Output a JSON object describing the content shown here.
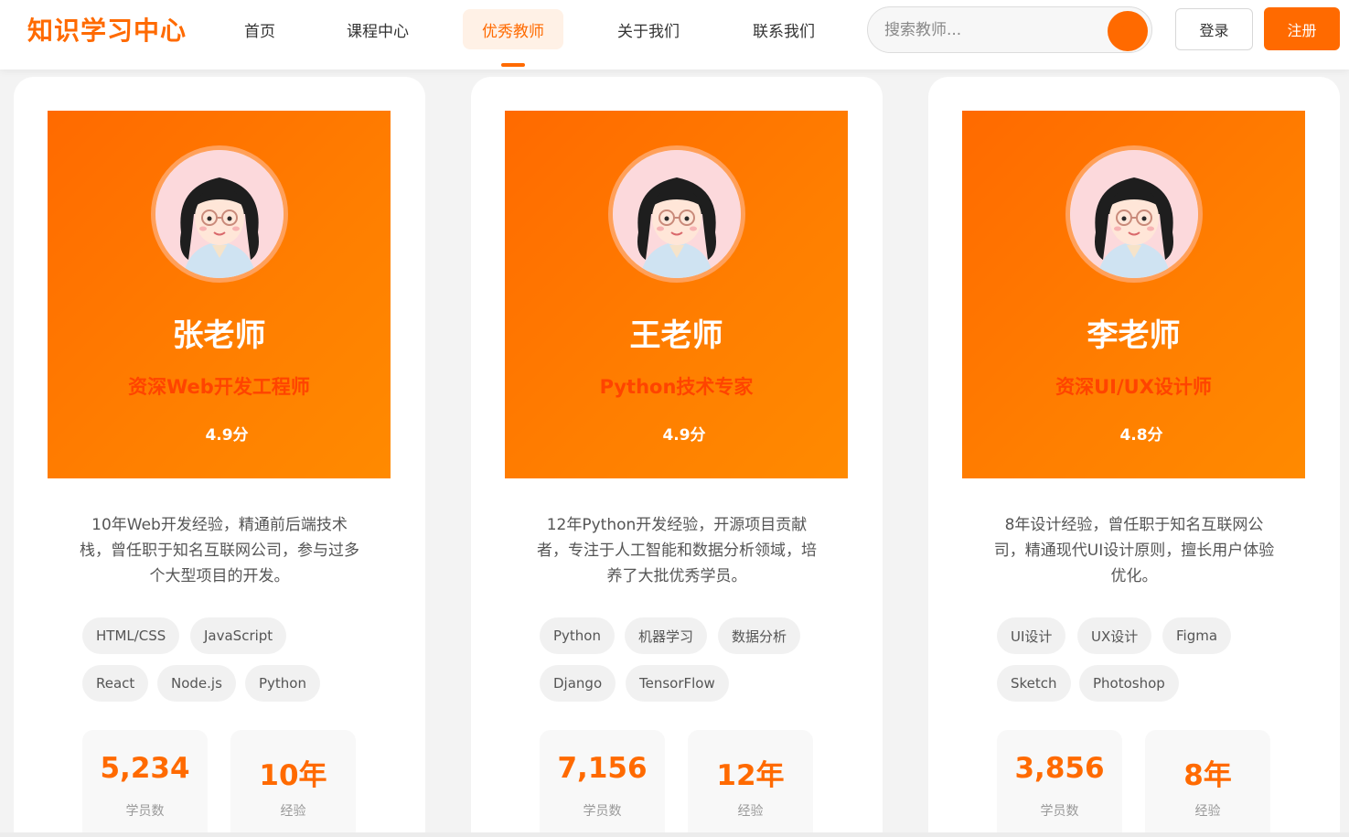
{
  "colors": {
    "accent": "#ff6a00",
    "title_on_hero": "#ff4400"
  },
  "header": {
    "logo": "知识学习中心",
    "nav": [
      "首页",
      "课程中心",
      "优秀教师",
      "关于我们",
      "联系我们"
    ],
    "active_nav": "优秀教师",
    "search": {
      "placeholder": "搜索教师...",
      "icon": "search-icon"
    },
    "login": "登录",
    "register": "注册"
  },
  "teachers": [
    {
      "name": "张老师",
      "title": "资深Web开发工程师",
      "rating": "4.9分",
      "desc": "10年Web开发经验，精通前后端技术栈，曾任职于知名互联网公司，参与过多个大型项目的开发。",
      "tags": [
        "HTML/CSS",
        "JavaScript",
        "React",
        "Node.js",
        "Python"
      ],
      "students": "5,234",
      "students_label": "学员数",
      "experience": "10年",
      "experience_label": "经验"
    },
    {
      "name": "王老师",
      "title": "Python技术专家",
      "rating": "4.9分",
      "desc": "12年Python开发经验，开源项目贡献者，专注于人工智能和数据分析领域，培养了大批优秀学员。",
      "tags": [
        "Python",
        "机器学习",
        "数据分析",
        "Django",
        "TensorFlow"
      ],
      "students": "7,156",
      "students_label": "学员数",
      "experience": "12年",
      "experience_label": "经验"
    },
    {
      "name": "李老师",
      "title": "资深UI/UX设计师",
      "rating": "4.8分",
      "desc": "8年设计经验，曾任职于知名互联网公司，精通现代UI设计原则，擅长用户体验优化。",
      "tags": [
        "UI设计",
        "UX设计",
        "Figma",
        "Sketch",
        "Photoshop"
      ],
      "students": "3,856",
      "students_label": "学员数",
      "experience": "8年",
      "experience_label": "经验"
    }
  ]
}
